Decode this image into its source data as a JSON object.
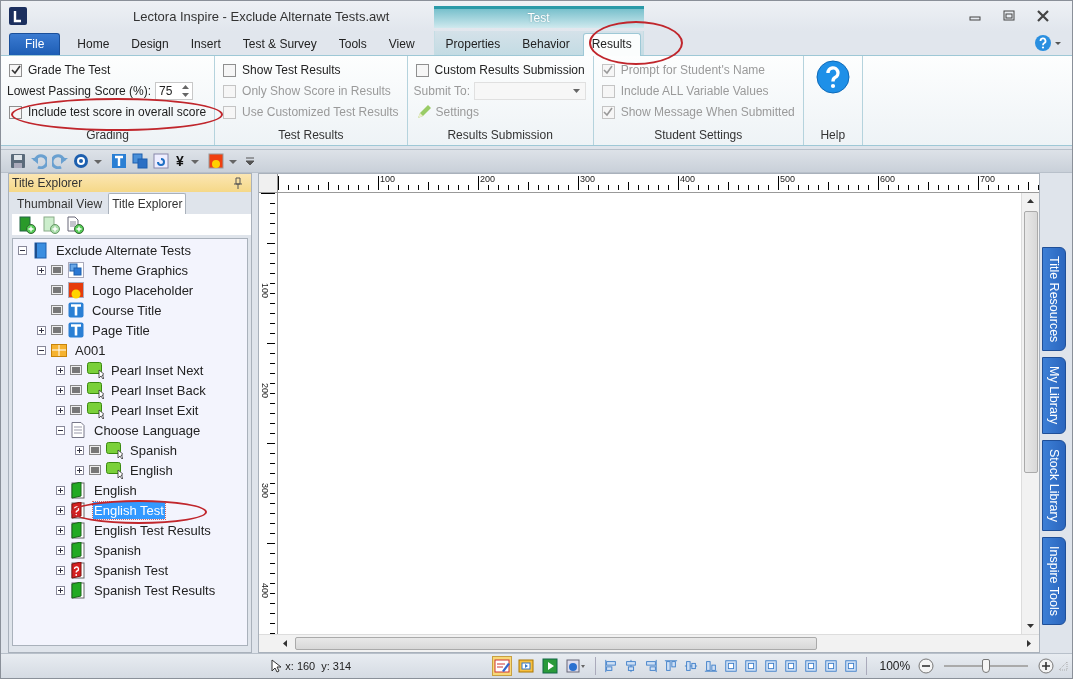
{
  "window": {
    "title": "Lectora Inspire - Exclude Alternate Tests.awt"
  },
  "contextual_group": {
    "label": "Test"
  },
  "tabs": [
    {
      "label": "File",
      "kind": "file",
      "selected": false
    },
    {
      "label": "Home",
      "kind": "normal",
      "selected": false
    },
    {
      "label": "Design",
      "kind": "normal",
      "selected": false
    },
    {
      "label": "Insert",
      "kind": "normal",
      "selected": false
    },
    {
      "label": "Test & Survey",
      "kind": "normal",
      "selected": false
    },
    {
      "label": "Tools",
      "kind": "normal",
      "selected": false
    },
    {
      "label": "View",
      "kind": "normal",
      "selected": false
    },
    {
      "label": "Properties",
      "kind": "contextual",
      "selected": false
    },
    {
      "label": "Behavior",
      "kind": "contextual",
      "selected": false
    },
    {
      "label": "Results",
      "kind": "contextual",
      "selected": true
    }
  ],
  "ribbon": {
    "groups": [
      {
        "label": "Grading",
        "controls": [
          {
            "kind": "checkbox",
            "label": "Grade The Test",
            "checked": true,
            "disabled": false
          },
          {
            "kind": "spinner",
            "label": "Lowest Passing Score (%):",
            "value": "75"
          },
          {
            "kind": "checkbox",
            "label": "Include test score in overall score",
            "checked": false,
            "disabled": false
          }
        ]
      },
      {
        "label": "Test Results",
        "controls": [
          {
            "kind": "checkbox",
            "label": "Show Test Results",
            "checked": false,
            "disabled": false
          },
          {
            "kind": "checkbox",
            "label": "Only Show Score in Results",
            "checked": false,
            "disabled": true
          },
          {
            "kind": "checkbox",
            "label": "Use Customized Test Results",
            "checked": false,
            "disabled": true
          }
        ]
      },
      {
        "label": "Results Submission",
        "controls": [
          {
            "kind": "checkbox",
            "label": "Custom Results Submission",
            "checked": false,
            "disabled": false
          },
          {
            "kind": "dropdown",
            "label": "Submit To:",
            "disabled": true
          },
          {
            "kind": "button",
            "label": "Settings",
            "disabled": true
          }
        ]
      },
      {
        "label": "Student Settings",
        "controls": [
          {
            "kind": "checkbox",
            "label": "Prompt for Student's Name",
            "checked": true,
            "disabled": true
          },
          {
            "kind": "checkbox",
            "label": "Include ALL Variable Values",
            "checked": false,
            "disabled": true
          },
          {
            "kind": "checkbox",
            "label": "Show Message When Submitted",
            "checked": true,
            "disabled": true
          }
        ]
      },
      {
        "label": "Help",
        "controls": [
          {
            "kind": "help"
          }
        ]
      }
    ]
  },
  "quick_toolbar": [
    {
      "kind": "save"
    },
    {
      "kind": "undo"
    },
    {
      "kind": "redo"
    },
    {
      "kind": "gear"
    },
    {
      "kind": "caret"
    },
    {
      "kind": "text"
    },
    {
      "kind": "layers"
    },
    {
      "kind": "refresh"
    },
    {
      "kind": "glyph",
      "text": "¥"
    },
    {
      "kind": "caret"
    },
    {
      "kind": "image"
    },
    {
      "kind": "caret"
    },
    {
      "kind": "overflow"
    }
  ],
  "explorer": {
    "title": "Title Explorer",
    "tabs": [
      {
        "label": "Thumbnail View",
        "selected": false
      },
      {
        "label": "Title Explorer",
        "selected": true
      }
    ],
    "tree": [
      {
        "label": "Exclude Alternate Tests",
        "kind": "book",
        "expanded": true,
        "selected": false,
        "children": [
          {
            "label": "Theme Graphics",
            "kind": "group",
            "expanded": false,
            "selected": false
          },
          {
            "label": "Logo Placeholder",
            "kind": "image",
            "selected": false
          },
          {
            "label": "Course Title",
            "kind": "text",
            "selected": false
          },
          {
            "label": "Page Title",
            "kind": "text",
            "expanded": false,
            "selected": false
          },
          {
            "label": "A001",
            "kind": "folder",
            "expanded": true,
            "selected": false,
            "children": [
              {
                "label": "Pearl Inset Next",
                "kind": "button",
                "expanded": false,
                "selected": false
              },
              {
                "label": "Pearl Inset Back",
                "kind": "button",
                "expanded": false,
                "selected": false
              },
              {
                "label": "Pearl Inset Exit",
                "kind": "button",
                "expanded": false,
                "selected": false
              },
              {
                "label": "Choose Language",
                "kind": "page",
                "expanded": true,
                "selected": false,
                "children": [
                  {
                    "label": "Spanish",
                    "kind": "button",
                    "expanded": false,
                    "selected": false
                  },
                  {
                    "label": "English",
                    "kind": "button",
                    "expanded": false,
                    "selected": false
                  }
                ]
              },
              {
                "label": "English",
                "kind": "chapter",
                "expanded": false,
                "selected": false
              },
              {
                "label": "English Test",
                "kind": "test",
                "expanded": false,
                "selected": true
              },
              {
                "label": "English Test Results",
                "kind": "chapter",
                "expanded": false,
                "selected": false
              },
              {
                "label": "Spanish",
                "kind": "chapter",
                "expanded": false,
                "selected": false
              },
              {
                "label": "Spanish Test",
                "kind": "test",
                "expanded": false,
                "selected": false
              },
              {
                "label": "Spanish Test Results",
                "kind": "chapter",
                "expanded": false,
                "selected": false
              }
            ]
          }
        ]
      }
    ]
  },
  "ruler": {
    "horizontal": [
      "100",
      "200",
      "300",
      "400",
      "500",
      "600",
      "700"
    ],
    "vertical": [
      "100",
      "200",
      "300",
      "400"
    ]
  },
  "side_tabs": [
    {
      "label": "Title Resources"
    },
    {
      "label": "My Library"
    },
    {
      "label": "Stock Library"
    },
    {
      "label": "Inspire Tools"
    }
  ],
  "status_bar": {
    "x": "x: 160",
    "y": "y: 314",
    "view_modes": [
      {
        "kind": "edit",
        "selected": true
      },
      {
        "kind": "preview",
        "selected": false
      },
      {
        "kind": "run",
        "selected": false
      },
      {
        "kind": "publish",
        "selected": false
      }
    ],
    "align_tools": [
      {
        "kind": "left"
      },
      {
        "kind": "center"
      },
      {
        "kind": "right"
      },
      {
        "kind": "top"
      },
      {
        "kind": "middle"
      },
      {
        "kind": "bottom"
      },
      {
        "kind": "same-width"
      },
      {
        "kind": "same-height"
      },
      {
        "kind": "space-h"
      },
      {
        "kind": "space-v"
      },
      {
        "kind": "center-page-v"
      },
      {
        "kind": "center-page-h"
      },
      {
        "kind": "same-size"
      }
    ],
    "zoom": "100%",
    "zoom_slider": {
      "level": 0.5
    }
  }
}
